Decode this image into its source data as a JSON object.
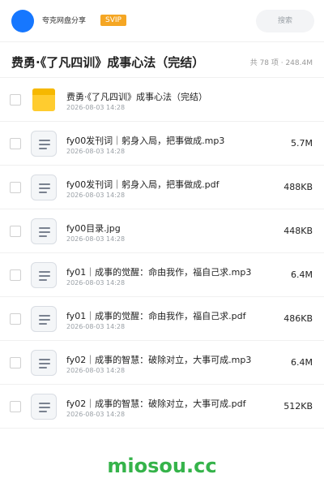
{
  "header": {
    "app_name": "夸克网盘分享",
    "badge": "SVIP",
    "search_placeholder": "搜索"
  },
  "folder": {
    "title": "费勇·《了凡四训》成事心法（完结）",
    "meta": "共 78 项 · 248.4M"
  },
  "files": [
    {
      "type": "folder",
      "name": "费勇·《了凡四训》成事心法（完结）",
      "date": "2026-08-03 14:28",
      "size": ""
    },
    {
      "type": "file",
      "name": "fy00发刊词｜躬身入局，把事做成.mp3",
      "date": "2026-08-03 14:28",
      "size": "5.7M"
    },
    {
      "type": "file",
      "name": "fy00发刊词｜躬身入局，把事做成.pdf",
      "date": "2026-08-03 14:28",
      "size": "488KB"
    },
    {
      "type": "file",
      "name": "fy00目录.jpg",
      "date": "2026-08-03 14:28",
      "size": "448KB"
    },
    {
      "type": "file",
      "name": "fy01｜成事的觉醒：命由我作，福自己求.mp3",
      "date": "2026-08-03 14:28",
      "size": "6.4M"
    },
    {
      "type": "file",
      "name": "fy01｜成事的觉醒：命由我作，福自己求.pdf",
      "date": "2026-08-03 14:28",
      "size": "486KB"
    },
    {
      "type": "file",
      "name": "fy02｜成事的智慧：破除对立，大事可成.mp3",
      "date": "2026-08-03 14:28",
      "size": "6.4M"
    },
    {
      "type": "file",
      "name": "fy02｜成事的智慧：破除对立，大事可成.pdf",
      "date": "2026-08-03 14:28",
      "size": "512KB"
    }
  ],
  "watermark": "miosou.cc",
  "colors": {
    "accent": "#1677ff",
    "svip": "#f5a623",
    "folder": "#ffcc2f",
    "watermark": "#35b34a"
  },
  "icons": {
    "folder": "folder-icon",
    "file": "document-icon"
  }
}
